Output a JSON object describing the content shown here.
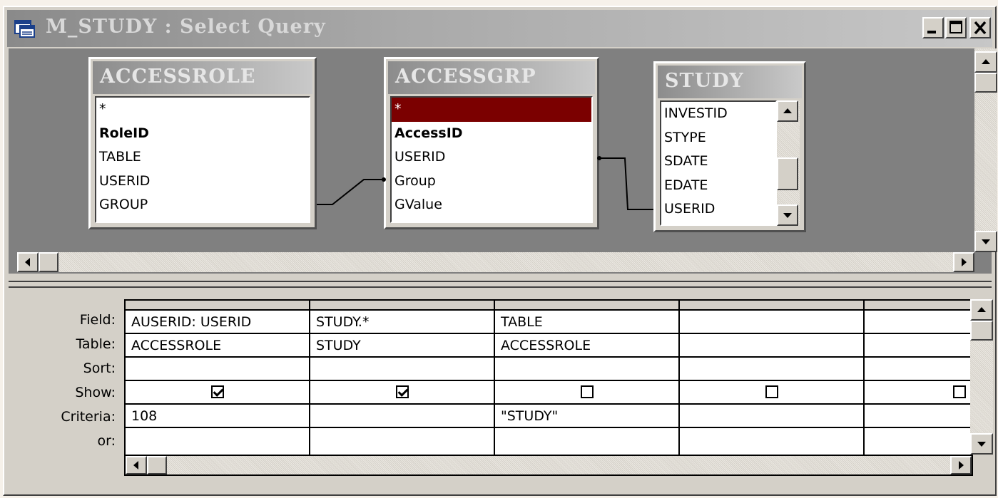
{
  "window": {
    "title": "M_STUDY : Select Query",
    "controls": {
      "minimize": "_",
      "maximize": "□",
      "close": "×"
    }
  },
  "tables": [
    {
      "name": "ACCESSROLE",
      "fields": [
        {
          "label": "*"
        },
        {
          "label": "RoleID",
          "key": true
        },
        {
          "label": "TABLE"
        },
        {
          "label": "USERID"
        },
        {
          "label": "GROUP"
        }
      ]
    },
    {
      "name": "ACCESSGRP",
      "fields": [
        {
          "label": "*",
          "selected": true
        },
        {
          "label": "AccessID",
          "key": true
        },
        {
          "label": "USERID"
        },
        {
          "label": "Group"
        },
        {
          "label": "GValue"
        }
      ]
    },
    {
      "name": "STUDY",
      "fields": [
        {
          "label": "INVESTID"
        },
        {
          "label": "STYPE"
        },
        {
          "label": "SDATE"
        },
        {
          "label": "EDATE"
        },
        {
          "label": "USERID"
        }
      ]
    }
  ],
  "grid": {
    "row_labels": [
      "Field:",
      "Table:",
      "Sort:",
      "Show:",
      "Criteria:",
      "or:"
    ],
    "columns": [
      {
        "field": "AUSERID: USERID",
        "table": "ACCESSROLE",
        "sort": "",
        "show": true,
        "criteria": "108",
        "or": ""
      },
      {
        "field": "STUDY.*",
        "table": "STUDY",
        "sort": "",
        "show": true,
        "criteria": "",
        "or": ""
      },
      {
        "field": "TABLE",
        "table": "ACCESSROLE",
        "sort": "",
        "show": false,
        "criteria": "\"STUDY\"",
        "or": ""
      },
      {
        "field": "",
        "table": "",
        "sort": "",
        "show": false,
        "criteria": "",
        "or": ""
      },
      {
        "field": "",
        "table": "",
        "sort": "",
        "show": false,
        "criteria": "",
        "or": ""
      }
    ]
  },
  "icons": [
    "query-window-icon",
    "scroll-up-icon",
    "scroll-down-icon",
    "scroll-left-icon",
    "scroll-right-icon"
  ],
  "colors": {
    "titlebar_start": "#8a8a8a",
    "titlebar_end": "#c7c7c7",
    "selected_field": "#7b0000",
    "pane": "#808080",
    "face": "#d4d0c8"
  }
}
